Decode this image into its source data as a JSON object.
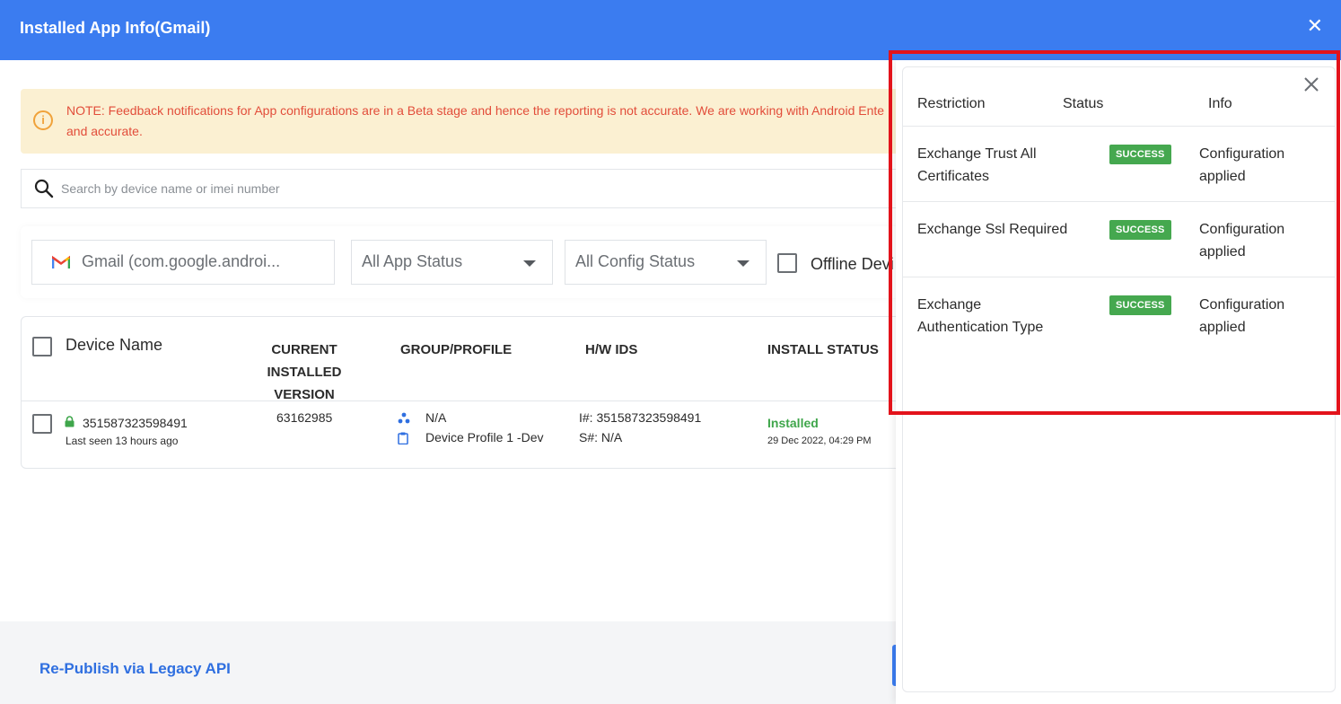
{
  "header": {
    "title": "Installed App Info(Gmail)",
    "close_label": "✕"
  },
  "note": {
    "icon": "i",
    "text": "NOTE: Feedback notifications for App configurations are in a Beta stage and hence the reporting is not accurate. We are working with Android Ente",
    "text_line2": "and accurate."
  },
  "search": {
    "placeholder": "Search by device name or imei number"
  },
  "filters": {
    "app": "Gmail (com.google.androi...",
    "app_status": "All App Status",
    "config_status": "All Config Status",
    "offline_label": "Offline Devi"
  },
  "table": {
    "headers": {
      "device_name": "Device Name",
      "version_line1": "CURRENT INSTALLED",
      "version_line2": "VERSION",
      "group": "GROUP/PROFILE",
      "hw": "H/W IDS",
      "install": "INSTALL STATUS"
    },
    "rows": [
      {
        "device_id": "351587323598491",
        "last_seen": "Last seen 13 hours ago",
        "version": "63162985",
        "group": "N/A",
        "profile": "Device Profile 1 -Dev",
        "imei": "I#: 351587323598491",
        "serial": "S#: N/A",
        "status": "Installed",
        "status_date": "29 Dec 2022, 04:29 PM"
      }
    ]
  },
  "footer": {
    "republish": "Re-Publish via Legacy API"
  },
  "panel": {
    "headers": {
      "restriction": "Restriction",
      "status": "Status",
      "info": "Info"
    },
    "rows": [
      {
        "restriction_l1": "Exchange Trust All",
        "restriction_l2": "Certificates",
        "status": "SUCCESS",
        "info_l1": "Configuration",
        "info_l2": "applied"
      },
      {
        "restriction_l1": "Exchange Ssl Required",
        "restriction_l2": "",
        "status": "SUCCESS",
        "info_l1": "Configuration",
        "info_l2": "applied"
      },
      {
        "restriction_l1": "Exchange",
        "restriction_l2": "Authentication Type",
        "status": "SUCCESS",
        "info_l1": "Configuration",
        "info_l2": "applied"
      }
    ]
  },
  "colors": {
    "primary": "#3b7cf0",
    "success": "#45a84f",
    "note_bg": "#fbf0d2",
    "note_text": "#e24d3a",
    "highlight": "#e3131b"
  }
}
